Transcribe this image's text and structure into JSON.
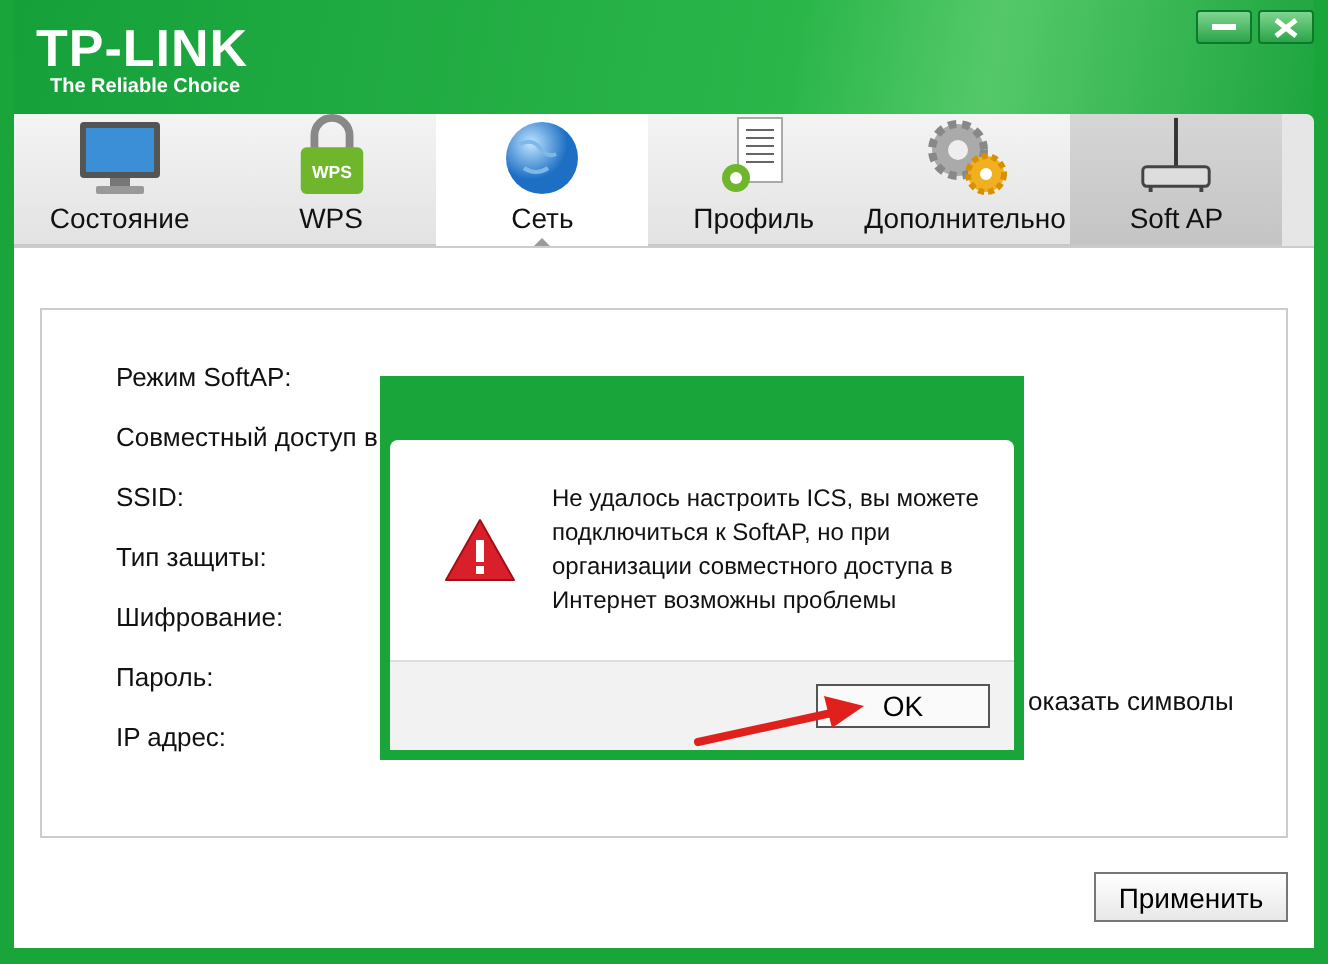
{
  "window": {
    "logo": "TP-LINK",
    "tagline": "The Reliable Choice"
  },
  "tabs": [
    {
      "label": "Состояние",
      "kind": "monitor",
      "selected": false,
      "highlighted": false
    },
    {
      "label": "WPS",
      "kind": "lock",
      "icon_label": "WPS",
      "selected": false,
      "highlighted": false
    },
    {
      "label": "Сеть",
      "kind": "globe",
      "selected": true,
      "highlighted": false
    },
    {
      "label": "Профиль",
      "kind": "profile",
      "selected": false,
      "highlighted": false
    },
    {
      "label": "Дополнительно",
      "kind": "gears",
      "selected": false,
      "highlighted": false
    },
    {
      "label": "Soft AP",
      "kind": "router",
      "selected": false,
      "highlighted": true
    }
  ],
  "form": {
    "labels": [
      "Режим SoftAP:",
      "Совместный доступ в",
      "SSID:",
      "Тип защиты:",
      "Шифрование:",
      "Пароль:",
      "IP адрес:"
    ],
    "show_chars": "оказать символы",
    "apply_button": "Применить"
  },
  "dialog": {
    "message": "Не удалось настроить ICS, вы можете подключиться к SoftAP, но при организации совместного доступа в Интернет возможны проблемы",
    "ok_button": "OK"
  }
}
